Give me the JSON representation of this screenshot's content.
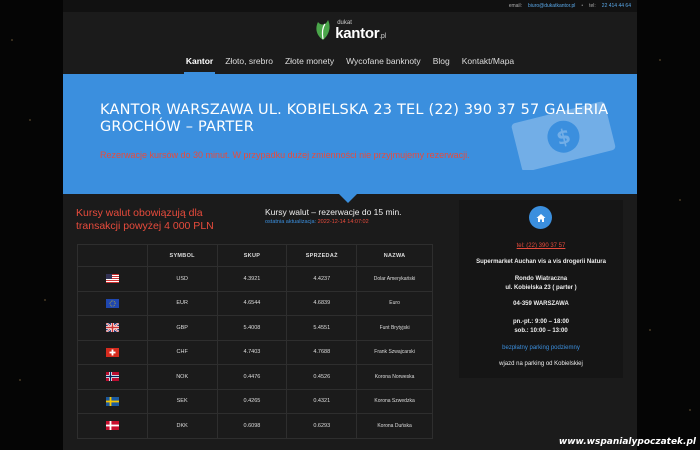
{
  "topbar": {
    "email_label": "email:",
    "email": "biuro@dukatkantor.pl",
    "tel_label": "tel:",
    "tel": "22 414 44 64"
  },
  "logo": {
    "small": "dukat",
    "big": "kantor",
    "tld": ".pl"
  },
  "nav": {
    "items": [
      {
        "label": "Kantor",
        "active": true
      },
      {
        "label": "Złoto, srebro"
      },
      {
        "label": "Złote monety"
      },
      {
        "label": "Wycofane banknoty"
      },
      {
        "label": "Blog"
      },
      {
        "label": "Kontakt/Mapa"
      }
    ]
  },
  "hero": {
    "title": "KANTOR WARSZAWA UL. KOBIELSKA 23 TEL (22) 390 37 57 GALERIA GROCHÓW – PARTER",
    "subtitle": "Rezerwacje kursów do 30 minut. W przypadku dużej zmienności nie przyjmujemy rezerwacji.",
    "accent_color": "#3b8fde"
  },
  "left_title": "Kursy walut obowiązują dla transakcji powyżej 4 000 PLN",
  "rates": {
    "heading": "Kursy walut – rezerwacje do 15 min.",
    "updated_label": "ostatnia aktualizacja:",
    "updated_value": "2022-12-14 14:07:02",
    "columns": [
      "",
      "SYMBOL",
      "SKUP",
      "SPRZEDAŻ",
      "NAZWA"
    ],
    "rows": [
      {
        "flag": "usa-flag",
        "symbol": "USD",
        "buy": "4.3921",
        "sell": "4.4237",
        "name": "Dolar Amerykański"
      },
      {
        "flag": "eu-flag",
        "symbol": "EUR",
        "buy": "4.6544",
        "sell": "4.6839",
        "name": "Euro"
      },
      {
        "flag": "uk-flag",
        "symbol": "GBP",
        "buy": "5.4008",
        "sell": "5.4551",
        "name": "Funt Brytyjski"
      },
      {
        "flag": "swiss-flag",
        "symbol": "CHF",
        "buy": "4.7403",
        "sell": "4.7688",
        "name": "Frank Szwajcarski"
      },
      {
        "flag": "norway-flag",
        "symbol": "NOK",
        "buy": "0.4476",
        "sell": "0.4526",
        "name": "Korona Norweska"
      },
      {
        "flag": "sweden-flag",
        "symbol": "SEK",
        "buy": "0.4265",
        "sell": "0.4321",
        "name": "Korona Szwedzka"
      },
      {
        "flag": "denmark-flag",
        "symbol": "DKK",
        "buy": "0.6098",
        "sell": "0.6293",
        "name": "Korona Duńska"
      }
    ]
  },
  "sidebar": {
    "tel": "tel: (22) 390 37 57",
    "place": "Supermarket Auchan vis a vis drogerii Natura",
    "roundabout": "Rondo Wiatraczna",
    "street": "ul. Kobielska 23 ( parter )",
    "city": "04-359 WARSZAWA",
    "hours_weekday": "pn.-pt.: 9:00 – 18:00",
    "hours_saturday": "sob.: 10:00 – 13:00",
    "parking": "bezpłatny parking podziemny",
    "entrance": "wjazd na parking od Kobielskiej"
  },
  "watermark": "www.wspanialypoczatek.pl"
}
